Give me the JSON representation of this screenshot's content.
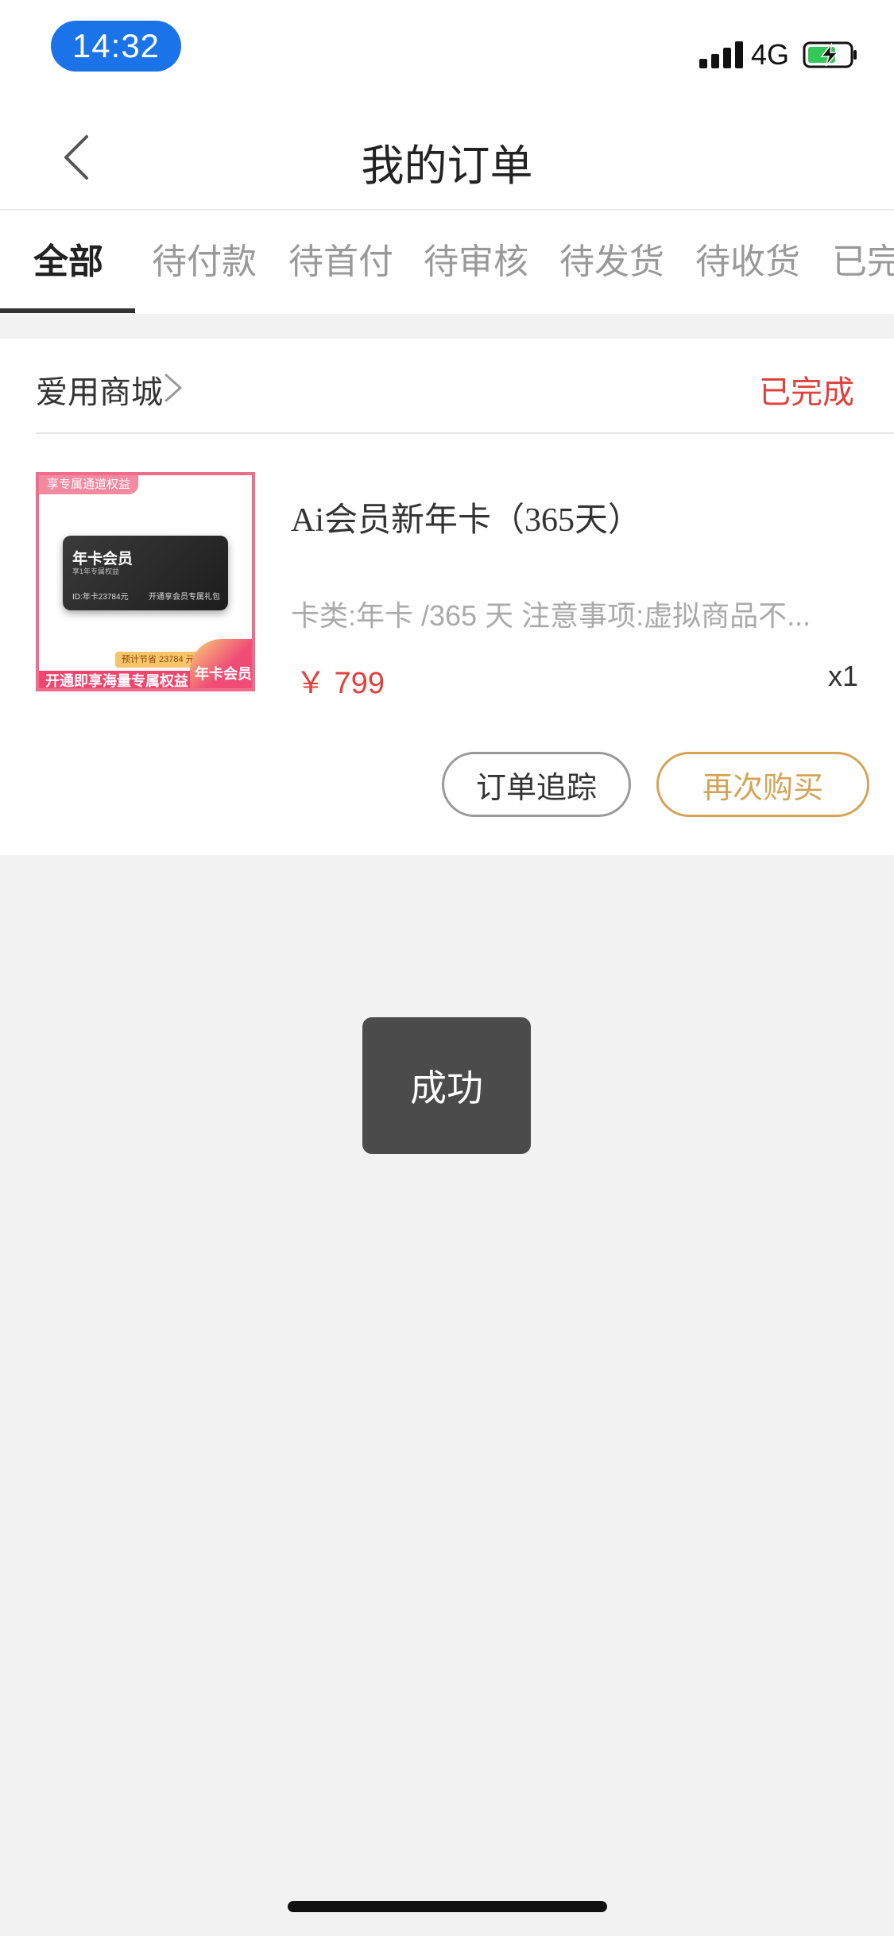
{
  "status_bar": {
    "time": "14:32",
    "network": "4G",
    "icons": [
      "signal-icon",
      "battery-charging-icon"
    ]
  },
  "nav": {
    "title": "我的订单",
    "back_icon": "chevron-left-icon"
  },
  "tabs": [
    {
      "label": "全部",
      "active": true
    },
    {
      "label": "待付款",
      "active": false
    },
    {
      "label": "待首付",
      "active": false
    },
    {
      "label": "待审核",
      "active": false
    },
    {
      "label": "待发货",
      "active": false
    },
    {
      "label": "待收货",
      "active": false
    },
    {
      "label": "已完",
      "active": false
    }
  ],
  "order": {
    "shop_name": "爱用商城",
    "status": "已完成",
    "thumbnail": {
      "tag": "享专属通道权益",
      "card_title": "年卡会员",
      "card_sub": "享1年专属权益",
      "card_number": "ID:年卡23784元",
      "card_right": "开通享会员专属礼包",
      "save_label": "预计节省 23784 元",
      "bottom_text": "开通即享海量专属权益",
      "badge_text": "年卡会员"
    },
    "product_name": "Ai会员新年卡（365天）",
    "description": "卡类:年卡 /365 天  注意事项:虚拟商品不...",
    "price": "￥ 799",
    "quantity": "x1",
    "buttons": {
      "track": "订单追踪",
      "rebuy": "再次购买"
    }
  },
  "toast": {
    "message": "成功"
  },
  "colors": {
    "status_red": "#e0413c",
    "rebuy_gold": "#d4a355",
    "time_pill_blue": "#1a73e8",
    "battery_green": "#34c759"
  }
}
